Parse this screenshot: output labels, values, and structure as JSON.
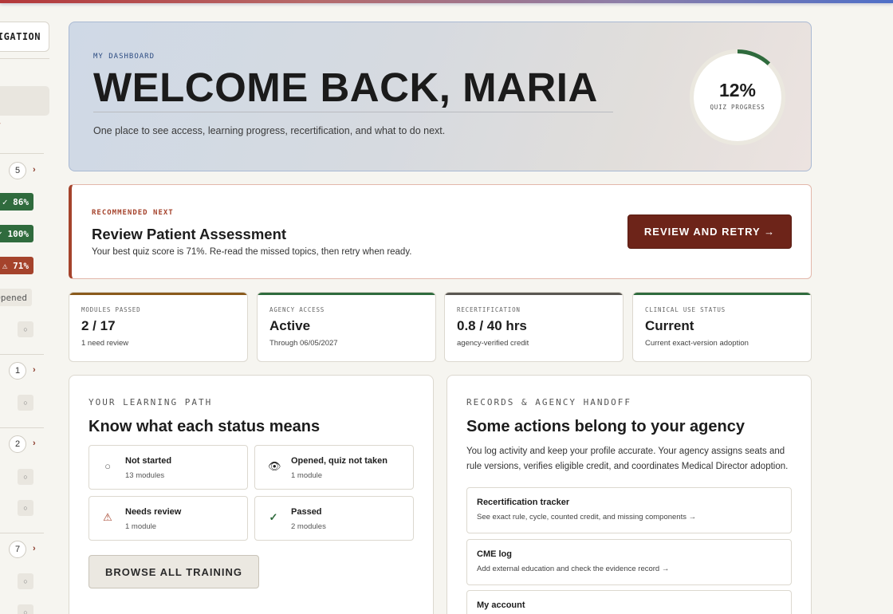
{
  "sidebar": {
    "nav_toggle": "IGATION",
    "link_fragment": "w",
    "groups": [
      {
        "count": "5",
        "chevron": "›"
      },
      {
        "count": "1",
        "chevron": "›"
      },
      {
        "count": "2",
        "chevron": "›"
      },
      {
        "count": "7",
        "chevron": "›"
      }
    ],
    "badges": [
      "✓ 86%",
      "✓ 100%",
      "⚠ 71%",
      "Opened"
    ],
    "not_started_glyph": "○"
  },
  "hero": {
    "eyebrow": "MY DASHBOARD",
    "title": "WELCOME BACK, MARIA",
    "subtitle": "One place to see access, learning progress, recertification, and what to do next.",
    "progress_text": "12%",
    "progress_label": "QUIZ PROGRESS",
    "progress_value": 0.12
  },
  "recommended": {
    "eyebrow": "RECOMMENDED NEXT",
    "title": "Review Patient Assessment",
    "subtitle": "Your best quiz score is 71%. Re-read the missed topics, then retry when ready.",
    "button": "REVIEW AND RETRY →"
  },
  "stats": [
    {
      "label": "MODULES PASSED",
      "value": "2 / 17",
      "note": "1 need review",
      "accent": "#8a5a1c"
    },
    {
      "label": "AGENCY ACCESS",
      "value": "Active",
      "note": "Through 06/05/2027",
      "accent": "#2f6b3d"
    },
    {
      "label": "RECERTIFICATION",
      "value": "0.8 / 40 hrs",
      "note": "agency-verified credit",
      "accent": "#5a5752"
    },
    {
      "label": "CLINICAL USE STATUS",
      "value": "Current",
      "note": "Current exact-version adoption",
      "accent": "#2f6b3d"
    }
  ],
  "learning": {
    "eyebrow": "YOUR LEARNING PATH",
    "title": "Know what each status means",
    "statuses": [
      {
        "icon": "○",
        "name": "Not started",
        "count": "13 modules"
      },
      {
        "icon": "👁",
        "name": "Opened, quiz not taken",
        "count": "1 module"
      },
      {
        "icon": "⚠",
        "name": "Needs review",
        "count": "1 module"
      },
      {
        "icon": "✓",
        "name": "Passed",
        "count": "2 modules"
      }
    ],
    "browse_button": "BROWSE ALL TRAINING"
  },
  "records": {
    "eyebrow": "RECORDS & AGENCY HANDOFF",
    "title": "Some actions belong to your agency",
    "description": "You log activity and keep your profile accurate. Your agency assigns seats and rule versions, verifies eligible credit, and coordinates Medical Director adoption.",
    "links": [
      {
        "title": "Recertification tracker",
        "desc": "See exact rule, cycle, counted credit, and missing components →"
      },
      {
        "title": "CME log",
        "desc": "Add external education and check the evidence record →"
      },
      {
        "title": "My account",
        "desc": ""
      }
    ]
  },
  "colors": {
    "accent_red": "#a5432c",
    "button_dark_red": "#6d2419",
    "success_green": "#2f6b3d",
    "eyebrow_blue": "#2d4c82"
  }
}
